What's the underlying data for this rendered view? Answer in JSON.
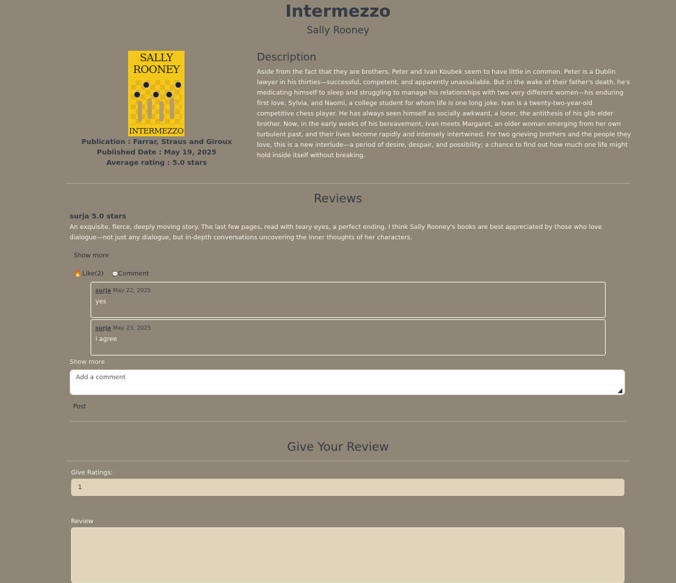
{
  "book": {
    "title": "Intermezzo",
    "author": "Sally Rooney",
    "cover_author_text": "SALLY ROONEY",
    "cover_title_text": "INTERMEZZO",
    "publication": "Publication : Farrar, Straus and Giroux",
    "published_date": "Published Date : May 19, 2025",
    "average_rating": "Average rating : 5.0 stars"
  },
  "description": {
    "heading": "Description",
    "text": "Aside from the fact that they are brothers, Peter and Ivan Koubek seem to have little in common. Peter is a Dublin lawyer in his thirties—successful, competent, and apparently unassailable. But in the wake of their father's death, he's medicating himself to sleep and struggling to manage his relationships with two very different women—his enduring first love, Sylvia, and Naomi, a college student for whom life is one long joke. Ivan is a twenty-two-year-old competitive chess player. He has always seen himself as socially awkward, a loner, the antithesis of his glib elder brother. Now, in the early weeks of his bereavement, Ivan meets Margaret, an older woman emerging from her own turbulent past, and their lives become rapidly and intensely intertwined. For two grieving brothers and the people they love, this is a new interlude—a period of desire, despair, and possibility; a chance to find out how much one life might hold inside itself without breaking."
  },
  "reviews": {
    "heading": "Reviews",
    "items": [
      {
        "user_line": "surja 5.0 stars",
        "text": "An exquisite, fierce, deeply moving story. The last few pages, read with teary eyes, a perfect ending. I think Sally Rooney's books are best appreciated by those who love dialogue—not just any dialogue, but in-depth conversations uncovering the inner thoughts of her characters.",
        "show_more": "Show more",
        "like_icon": "🔥",
        "like_label": "Like(2)",
        "comment_icon": "💬",
        "comment_label": "Comment",
        "comments": [
          {
            "user": "surja",
            "date": " May 22, 2025",
            "text": "yes"
          },
          {
            "user": "surja",
            "date": " May 23, 2025",
            "text": "i agree"
          }
        ],
        "comments_show_more": "Show more",
        "add_comment_placeholder": "Add a comment",
        "post_label": "Post"
      }
    ]
  },
  "give_review": {
    "heading": "Give Your Review",
    "ratings_label": "Give Ratings:",
    "ratings_value": "1",
    "review_label": "Review",
    "review_value": ""
  }
}
